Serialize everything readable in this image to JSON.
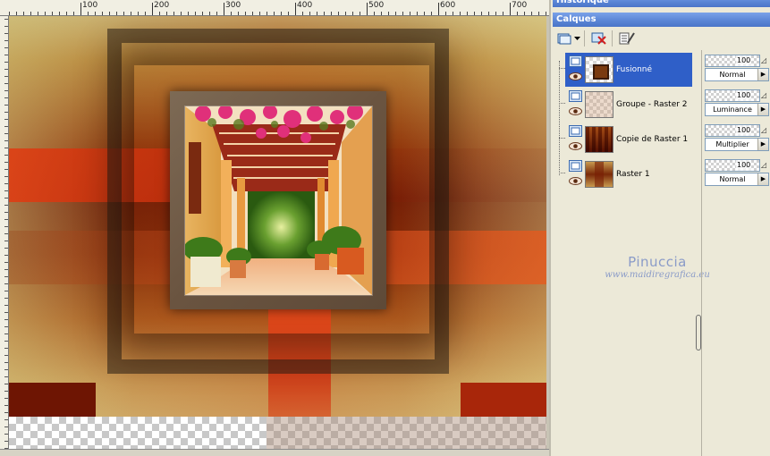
{
  "ruler": {
    "labels": [
      "100",
      "200",
      "300",
      "400",
      "500",
      "600",
      "700"
    ]
  },
  "palettes": {
    "history_title": "Historique",
    "layers_title": "Calques"
  },
  "toolbar": {
    "icons": [
      "new-layer-icon",
      "dropdown-arrow-icon",
      "delete-layer-icon",
      "layer-properties-icon"
    ]
  },
  "layers": [
    {
      "name": "Fusionné",
      "selected": true,
      "opacity": "100",
      "blend_mode": "Normal"
    },
    {
      "name": "Groupe - Raster 2",
      "selected": false,
      "opacity": "100",
      "blend_mode": "Luminance"
    },
    {
      "name": "Copie de Raster 1",
      "selected": false,
      "opacity": "100",
      "blend_mode": "Multiplier"
    },
    {
      "name": "Raster 1",
      "selected": false,
      "opacity": "100",
      "blend_mode": "Normal"
    }
  ],
  "watermark": {
    "title": "Pinuccia",
    "site": "www.maidiregrafica.eu"
  },
  "colors": {
    "selection": "#2f5fc8",
    "title_bar": "#5b86d6",
    "dock_bg": "#ece9d8"
  }
}
